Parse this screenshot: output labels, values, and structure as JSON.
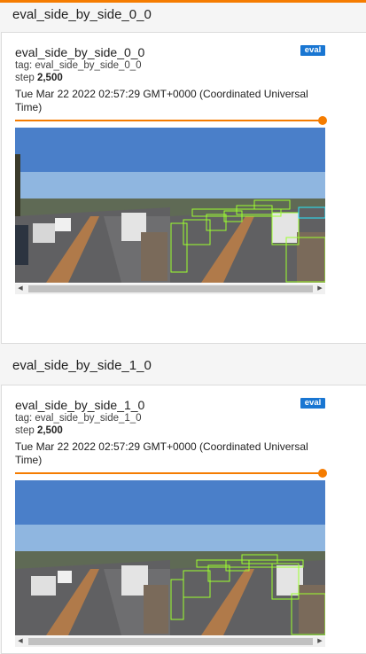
{
  "accent_color": "#f57c00",
  "badge_color": "#1976d2",
  "sections": [
    {
      "title": "eval_side_by_side_0_0",
      "card": {
        "title": "eval_side_by_side_0_0",
        "tag": "tag: eval_side_by_side_0_0",
        "step_label": "step",
        "step_value": "2,500",
        "timestamp": "Tue Mar 22 2022 02:57:29 GMT+0000 (Coordinated Universal Time)",
        "run_badge": "eval",
        "slider_value": 1.0,
        "image_icon": "road-scene-side-by-side-image"
      }
    },
    {
      "title": "eval_side_by_side_1_0",
      "card": {
        "title": "eval_side_by_side_1_0",
        "tag": "tag: eval_side_by_side_1_0",
        "step_label": "step",
        "step_value": "2,500",
        "timestamp": "Tue Mar 22 2022 02:57:29 GMT+0000 (Coordinated Universal Time)",
        "run_badge": "eval",
        "slider_value": 1.0,
        "image_icon": "road-scene-side-by-side-image"
      }
    }
  ]
}
